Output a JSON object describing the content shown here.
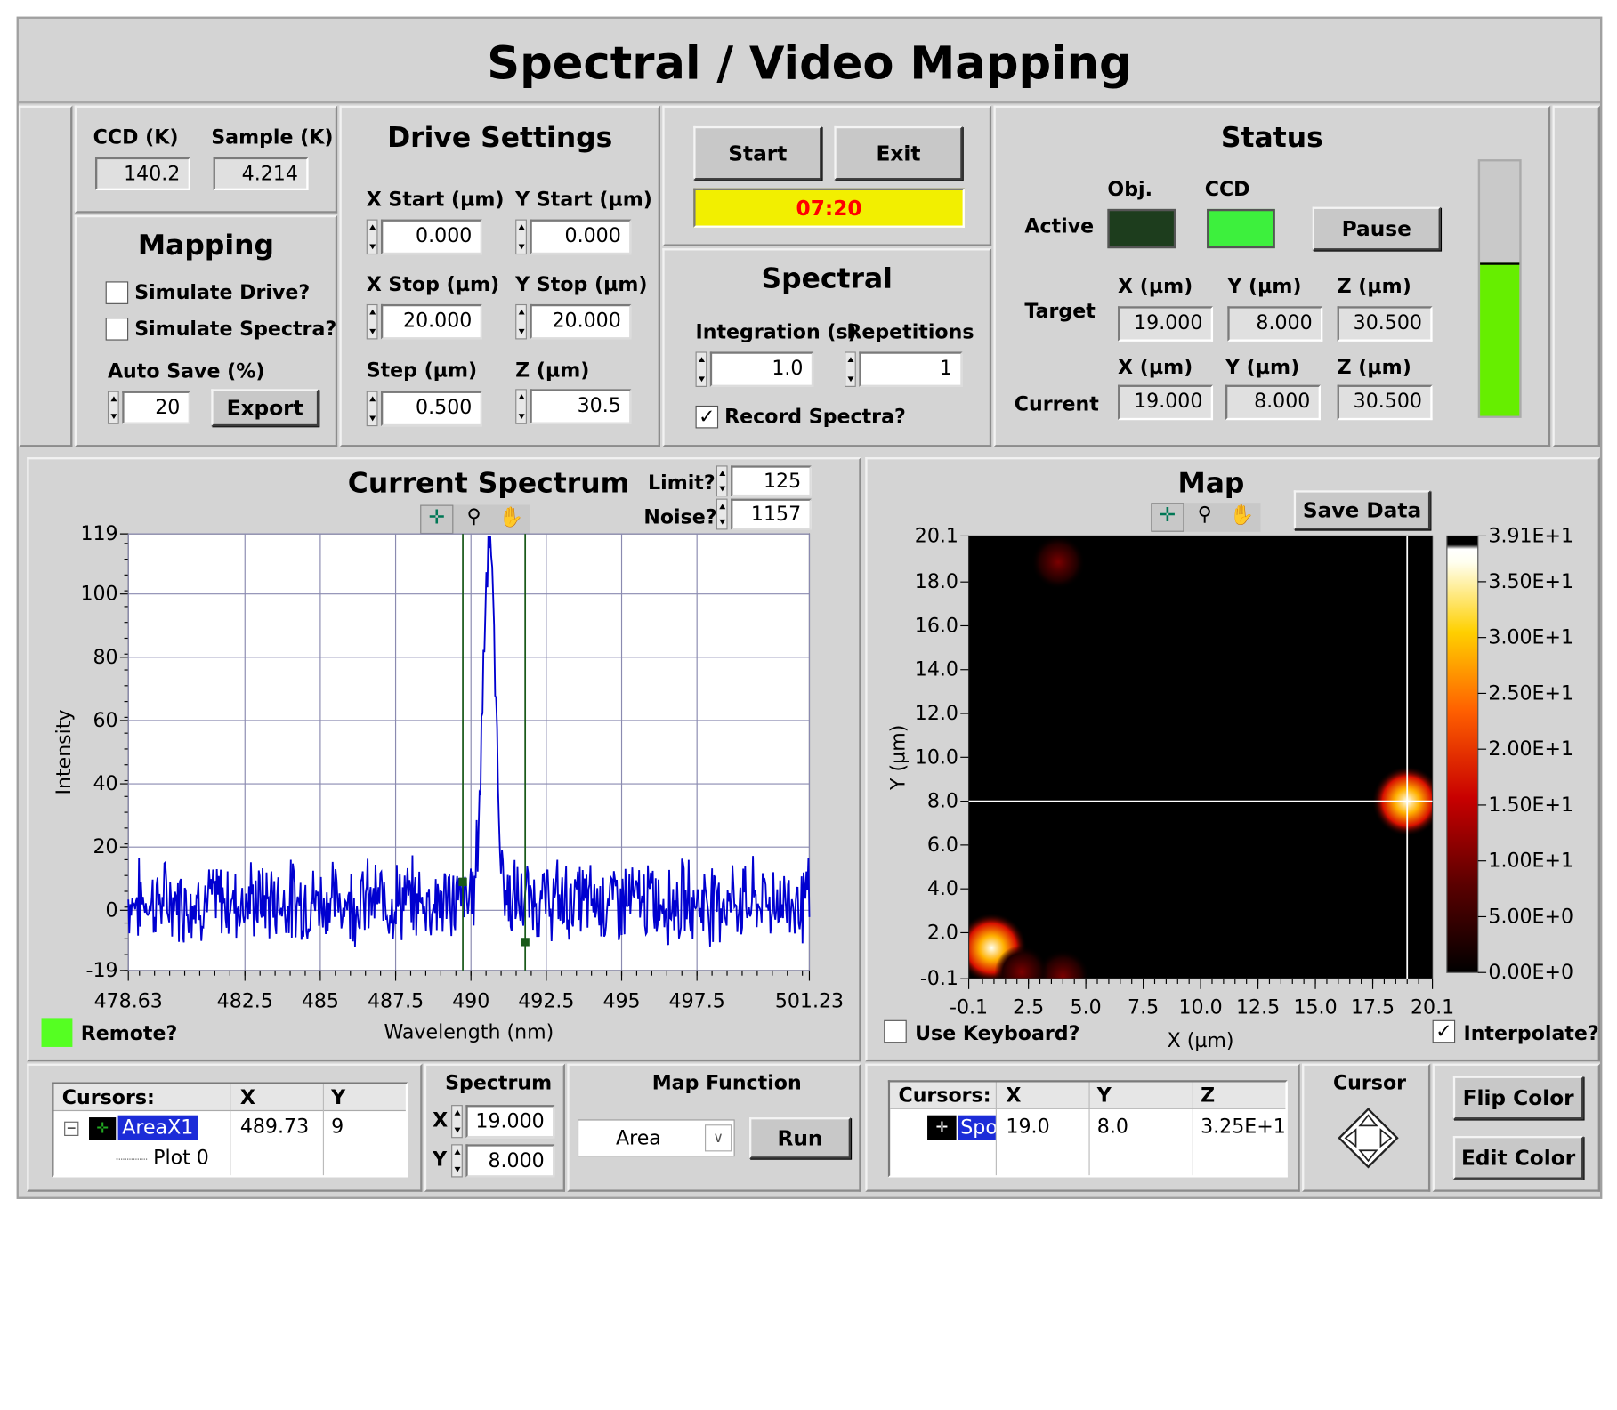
{
  "title": "Spectral / Video Mapping",
  "temps": {
    "ccd_label": "CCD (K)",
    "ccd_value": "140.2",
    "sample_label": "Sample (K)",
    "sample_value": "4.214"
  },
  "mapping": {
    "title": "Mapping",
    "simulate_drive": "Simulate Drive?",
    "simulate_spectra": "Simulate Spectra?",
    "auto_save_label": "Auto Save (%)",
    "auto_save_value": "20",
    "export_label": "Export"
  },
  "drive": {
    "title": "Drive Settings",
    "x_start_label": "X Start (µm)",
    "x_start": "0.000",
    "y_start_label": "Y Start (µm)",
    "y_start": "0.000",
    "x_stop_label": "X Stop (µm)",
    "x_stop": "20.000",
    "y_stop_label": "Y Stop (µm)",
    "y_stop": "20.000",
    "step_label": "Step (µm)",
    "step": "0.500",
    "z_label": "Z (µm)",
    "z": "30.5"
  },
  "controls": {
    "start": "Start",
    "exit": "Exit",
    "timer": "07:20",
    "timer_bg": "#f2ef00",
    "timer_fg": "#ff0000"
  },
  "spectral": {
    "title": "Spectral",
    "integration_label": "Integration (s)",
    "integration": "1.0",
    "repetitions_label": "Repetitions",
    "repetitions": "1",
    "record_label": "Record Spectra?",
    "record_checked": true
  },
  "status": {
    "title": "Status",
    "active_label": "Active",
    "obj_label": "Obj.",
    "ccd_label": "CCD",
    "obj_led": "#1d3d1d",
    "ccd_led": "#3df03d",
    "pause": "Pause",
    "target_label": "Target",
    "current_label": "Current",
    "x_label": "X (µm)",
    "y_label": "Y (µm)",
    "z_label": "Z (µm)",
    "target_x": "19.000",
    "target_y": "8.000",
    "target_z": "30.500",
    "current_x": "19.000",
    "current_y": "8.000",
    "current_z": "30.500",
    "level_fraction": 0.6,
    "level_color": "#66ee00"
  },
  "spectrum": {
    "title": "Current Spectrum",
    "limit_label": "Limit?",
    "limit": "125",
    "noise_label": "Noise?",
    "noise": "1157",
    "remote_label": "Remote?",
    "remote_color": "#55ff22"
  },
  "map": {
    "title": "Map",
    "save_data": "Save Data",
    "use_keyboard": "Use Keyboard?",
    "interpolate": "Interpolate?",
    "interpolate_checked": true
  },
  "cursors_left": {
    "header": "Cursors:",
    "x_header": "X",
    "y_header": "Y",
    "name": "AreaX1",
    "x": "489.73",
    "y": "9",
    "plot": "Plot 0"
  },
  "spectrum_pos": {
    "title": "Spectrum",
    "x_label": "X",
    "x": "19.000",
    "y_label": "Y",
    "y": "8.000"
  },
  "map_function": {
    "title": "Map Function",
    "selected": "Area",
    "run": "Run"
  },
  "cursors_right": {
    "header": "Cursors:",
    "x_header": "X",
    "y_header": "Y",
    "z_header": "Z",
    "name": "Spo",
    "x": "19.0",
    "y": "8.0",
    "z": "3.25E+1"
  },
  "cursor_label": "Cursor",
  "flip_color": "Flip Color",
  "edit_color": "Edit Color",
  "chart_data": [
    {
      "type": "line",
      "xlabel": "Wavelength (nm)",
      "ylabel": "Intensity",
      "xlim": [
        478.63,
        501.23
      ],
      "ylim": [
        -19,
        119
      ],
      "x_ticks": [
        "478.63",
        "482.5",
        "485",
        "487.5",
        "490",
        "492.5",
        "495",
        "497.5",
        "501.23"
      ],
      "y_ticks": [
        "119",
        "100",
        "80",
        "60",
        "40",
        "20",
        "0",
        "-19"
      ],
      "grid": true,
      "series": [
        {
          "color": "#0000d0",
          "noise_mean": 3,
          "noise_amplitude": 10,
          "peak_center": 490.6,
          "peak_height": 119,
          "peak_width": 0.2
        }
      ],
      "cursors": [
        489.73,
        491.8
      ]
    },
    {
      "type": "heatmap",
      "xlabel": "X (µm)",
      "ylabel": "Y (µm)",
      "xlim": [
        -0.1,
        20.1
      ],
      "ylim": [
        -0.1,
        20.1
      ],
      "x_ticks": [
        "-0.1",
        "2.5",
        "5.0",
        "7.5",
        "10.0",
        "12.5",
        "15.0",
        "17.5",
        "20.1"
      ],
      "y_ticks": [
        "20.1",
        "18.0",
        "16.0",
        "14.0",
        "12.0",
        "10.0",
        "8.0",
        "6.0",
        "4.0",
        "2.0",
        "-0.1"
      ],
      "colorbar_ticks": [
        "3.91E+1",
        "3.50E+1",
        "3.00E+1",
        "2.50E+1",
        "2.00E+1",
        "1.50E+1",
        "1.00E+1",
        "5.00E+0",
        "0.00E+0"
      ],
      "zlim": [
        0,
        39.1
      ],
      "cursor": [
        19.0,
        8.0
      ],
      "hotspots": [
        {
          "x": 19.0,
          "y": 8.0,
          "z": 32.5
        },
        {
          "x": 0.9,
          "y": 1.3,
          "z": 39.1
        },
        {
          "x": 4.0,
          "y": 0.0,
          "z": 7.0
        },
        {
          "x": 3.8,
          "y": 18.9,
          "z": 8.0
        },
        {
          "x": 2.2,
          "y": 0.2,
          "z": 6.0
        }
      ]
    }
  ]
}
